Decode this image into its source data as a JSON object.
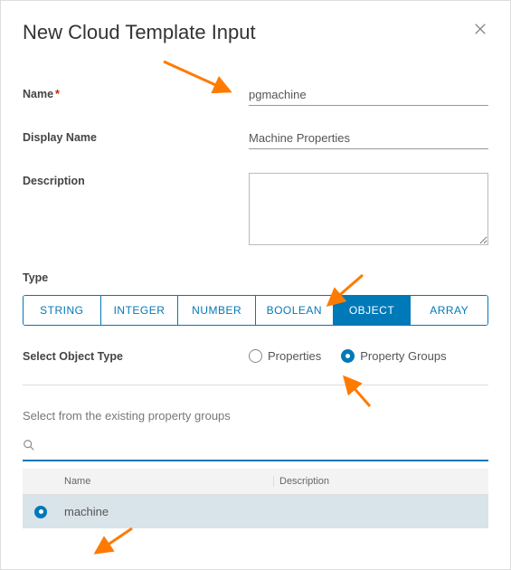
{
  "dialog": {
    "title": "New Cloud Template Input"
  },
  "form": {
    "name_label": "Name",
    "name_value": "pgmachine",
    "display_name_label": "Display Name",
    "display_name_value": "Machine Properties",
    "description_label": "Description",
    "description_value": ""
  },
  "type": {
    "label": "Type",
    "options": [
      "STRING",
      "INTEGER",
      "NUMBER",
      "BOOLEAN",
      "OBJECT",
      "ARRAY"
    ],
    "selected": "OBJECT"
  },
  "object_type": {
    "label": "Select Object Type",
    "options": [
      {
        "label": "Properties",
        "selected": false
      },
      {
        "label": "Property Groups",
        "selected": true
      }
    ]
  },
  "property_groups": {
    "heading": "Select from the existing property groups",
    "search_value": "",
    "columns": {
      "name": "Name",
      "description": "Description"
    },
    "rows": [
      {
        "name": "machine",
        "description": "",
        "selected": true
      }
    ]
  }
}
